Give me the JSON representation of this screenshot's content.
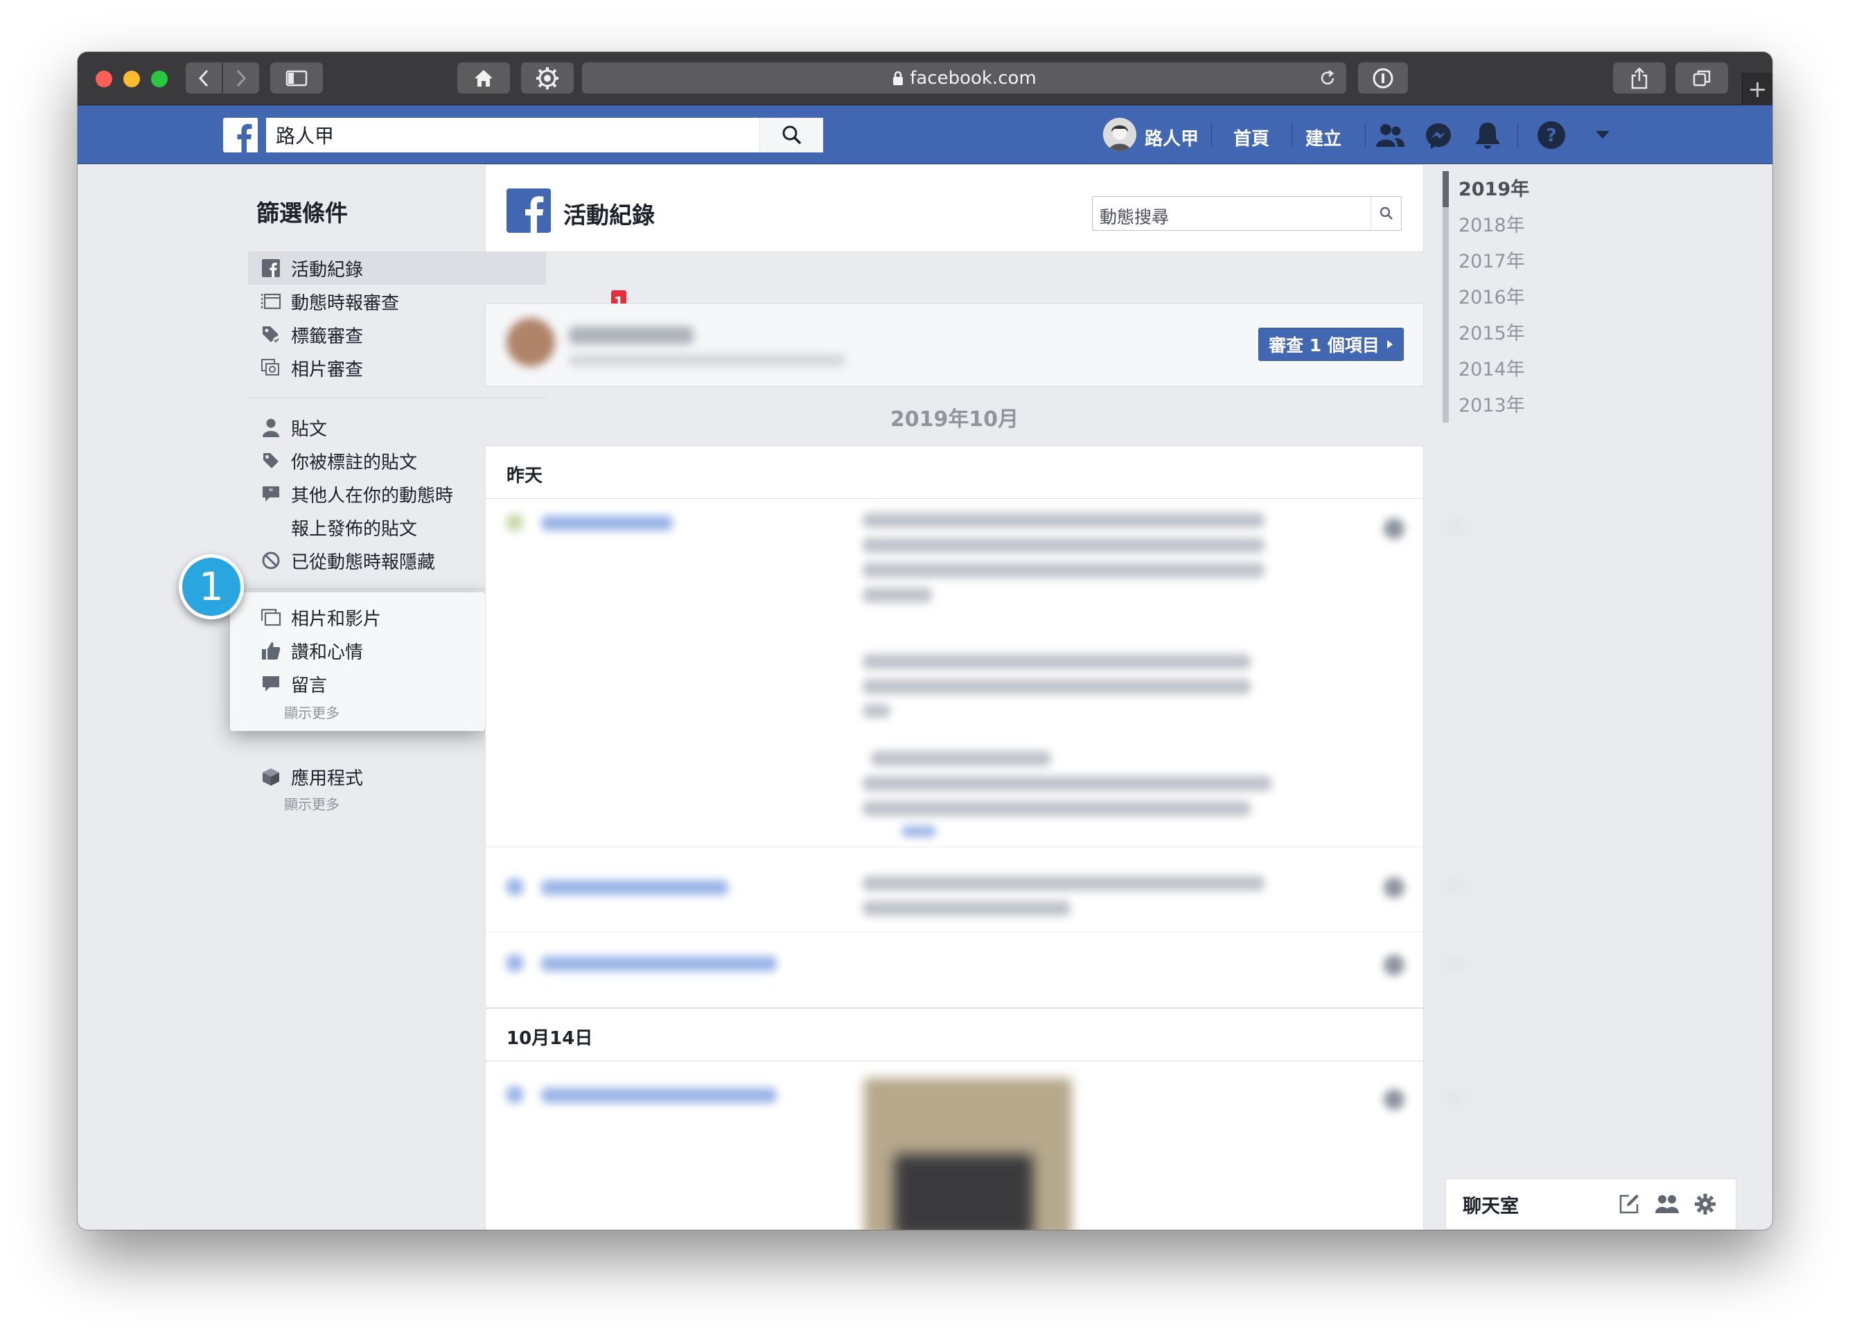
{
  "browser": {
    "url": "facebook.com",
    "new_tab_label": "+"
  },
  "fb": {
    "search_value": "路人甲",
    "profile_name": "路人甲",
    "nav_home": "首頁",
    "nav_create": "建立",
    "brand_color": "#4267b2"
  },
  "filters": {
    "title": "篩選條件",
    "group1": [
      {
        "label": "活動紀錄",
        "icon": "facebook-icon"
      },
      {
        "label": "動態時報審查",
        "icon": "timeline-review-icon",
        "badge": "1"
      },
      {
        "label": "標籤審查",
        "icon": "tag-review-icon"
      },
      {
        "label": "相片審查",
        "icon": "photo-review-icon"
      }
    ],
    "group2": [
      {
        "label": "貼文",
        "icon": "person-icon"
      },
      {
        "label": "你被標註的貼文",
        "icon": "tag-icon"
      },
      {
        "label": "其他人在你的動態時",
        "icon": "quote-icon"
      },
      {
        "label": "報上發佈的貼文",
        "icon": ""
      },
      {
        "label": "已從動態時報隱藏",
        "icon": "hidden-icon"
      }
    ],
    "group3": [
      {
        "label": "相片和影片",
        "icon": "photos-icon"
      },
      {
        "label": "讚和心情",
        "icon": "like-icon"
      },
      {
        "label": "留言",
        "icon": "comment-icon"
      }
    ],
    "group3_more": "顯示更多",
    "group4": [
      {
        "label": "應用程式",
        "icon": "apps-icon"
      }
    ],
    "group4_more": "顯示更多"
  },
  "callout": {
    "number": "1"
  },
  "activity": {
    "title": "活動紀錄",
    "search_placeholder": "動態搜尋",
    "review_button": "審查 1 個項目",
    "month_heading": "2019年10月",
    "section1": "昨天",
    "section2": "10月14日"
  },
  "years": [
    "2019年",
    "2018年",
    "2017年",
    "2016年",
    "2015年",
    "2014年",
    "2013年"
  ],
  "chat": {
    "label": "聊天室"
  }
}
